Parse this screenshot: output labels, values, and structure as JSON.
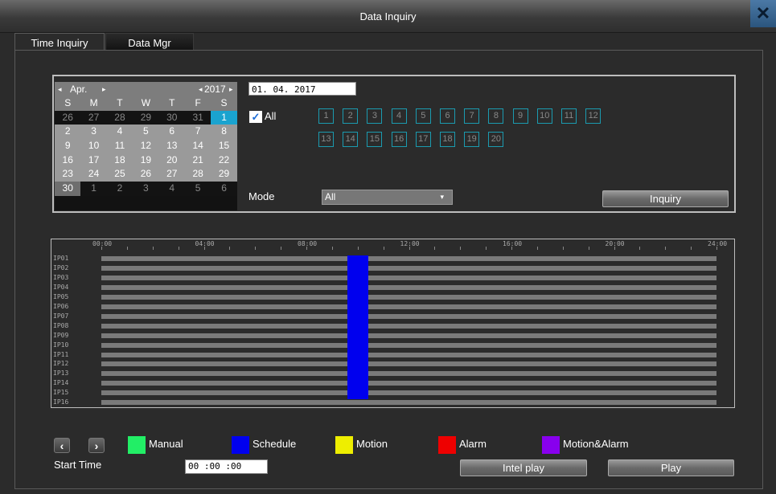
{
  "window": {
    "title": "Data Inquiry",
    "close_glyph": "✕"
  },
  "tabs": [
    {
      "label": "Time Inquiry",
      "active": true
    },
    {
      "label": "Data Mgr",
      "active": false
    }
  ],
  "calendar": {
    "month": "Apr.",
    "year": "2017",
    "prev_arrow": "◂",
    "next_arrow": "▸",
    "weekdays": [
      "S",
      "M",
      "T",
      "W",
      "T",
      "F",
      "S"
    ],
    "weeks": [
      [
        "26",
        "27",
        "28",
        "29",
        "30",
        "31",
        "1"
      ],
      [
        "2",
        "3",
        "4",
        "5",
        "6",
        "7",
        "8"
      ],
      [
        "9",
        "10",
        "11",
        "12",
        "13",
        "14",
        "15"
      ],
      [
        "16",
        "17",
        "18",
        "19",
        "20",
        "21",
        "22"
      ],
      [
        "23",
        "24",
        "25",
        "26",
        "27",
        "28",
        "29"
      ],
      [
        "30",
        "1",
        "2",
        "3",
        "4",
        "5",
        "6"
      ]
    ],
    "selected_day": "1"
  },
  "date_field": "01. 04. 2017",
  "all_checkbox": {
    "label": "All",
    "checked": true,
    "glyph": "✓"
  },
  "channels": [
    "1",
    "2",
    "3",
    "4",
    "5",
    "6",
    "7",
    "8",
    "9",
    "10",
    "11",
    "12",
    "13",
    "14",
    "15",
    "16",
    "17",
    "18",
    "19",
    "20"
  ],
  "mode": {
    "label": "Mode",
    "value": "All",
    "arrow": "▾"
  },
  "inquiry_button": "Inquiry",
  "timeline": {
    "hours": [
      "00:00",
      "04:00",
      "08:00",
      "12:00",
      "16:00",
      "20:00",
      "24:00"
    ],
    "channels": [
      "IP01",
      "IP02",
      "IP03",
      "IP04",
      "IP05",
      "IP06",
      "IP07",
      "IP08",
      "IP09",
      "IP10",
      "IP11",
      "IP12",
      "IP13",
      "IP14",
      "IP15",
      "IP16"
    ],
    "recording": {
      "type": "Schedule",
      "start_hour": 9.6,
      "end_hour": 10.4,
      "channels_count": 15
    }
  },
  "nav": {
    "prev": "‹",
    "next": "›"
  },
  "legend": [
    {
      "label": "Manual",
      "color": "#22ee66"
    },
    {
      "label": "Schedule",
      "color": "#0000ee"
    },
    {
      "label": "Motion",
      "color": "#eeee00"
    },
    {
      "label": "Alarm",
      "color": "#ee0000"
    },
    {
      "label": "Motion&Alarm",
      "color": "#8800ee"
    }
  ],
  "start_time": {
    "label": "Start Time",
    "value": "00 :00 :00"
  },
  "buttons": {
    "intel_play": "Intel  play",
    "play": "Play"
  }
}
